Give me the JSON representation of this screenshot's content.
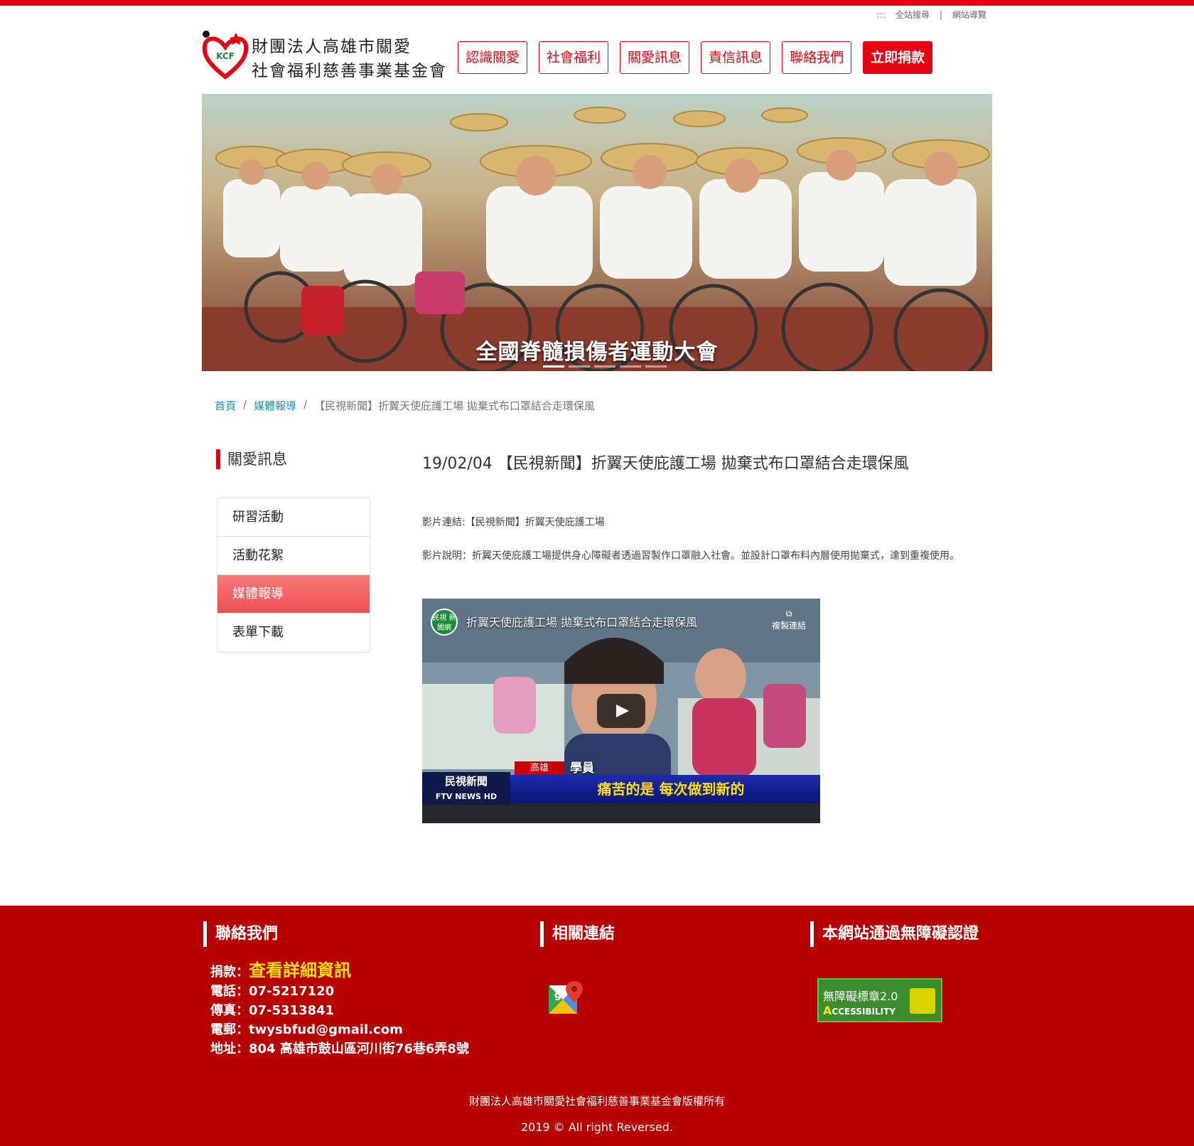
{
  "utility": {
    "prefix": ":::",
    "search": "全站搜尋",
    "sep": "|",
    "sitemap": "網站導覽"
  },
  "org": {
    "line1": "財團法人高雄市關愛",
    "line2": "社會福利慈善事業基金會",
    "logo_text": "KCF"
  },
  "nav": [
    "認識關愛",
    "社會福利",
    "關愛訊息",
    "責信訊息",
    "聯絡我們"
  ],
  "nav_donate": "立即捐款",
  "banner": {
    "caption": "全國脊髓損傷者運動大會"
  },
  "breadcrumb": {
    "home": "首頁",
    "section": "媒體報導",
    "current": "【民視新聞】折翼天使庇護工場 拋棄式布口罩結合走環保風",
    "sep": "/"
  },
  "sidebar": {
    "title": "關愛訊息",
    "items": [
      "研習活動",
      "活動花絮",
      "媒體報導",
      "表單下載"
    ],
    "active": "媒體報導"
  },
  "article": {
    "title": "19/02/04 【民視新聞】折翼天使庇護工場 拋棄式布口罩結合走環保風",
    "link_line": "影片連結:【民視新聞】折翼天使庇護工場",
    "desc_line": "影片說明：折翼天使庇護工場提供身心障礙者透過習製作口罩融入社會。並設計口罩布料內層使用拋棄式，達到重複使用。"
  },
  "video": {
    "title": "折翼天使庇護工場 拋棄式布口罩結合走環保風",
    "channel": "民視 新聞網",
    "copy_label": "複製連結",
    "location_tag": "高雄",
    "speaker_tag": "學員",
    "logo_line1": "民視新聞",
    "logo_line2": "FTV NEWS HD",
    "subtitle": "痛苦的是 每次做到新的"
  },
  "footer": {
    "contact_title": "聯絡我們",
    "links_title": "相關連結",
    "a11y_title": "本網站通過無障礙認證",
    "donate_label": "捐款：",
    "donate_link": "查看詳細資訊",
    "phone": "電話：07-5217120",
    "fax": "傳真：07-5313841",
    "email": "電郵：twysbfud@gmail.com",
    "address": "地址：804 高雄市鼓山區河川街76巷6弄8號",
    "a11y_badge_line1": "無障礙標章2.0",
    "a11y_badge_line2": "CCESSIBILITY",
    "copyright1": "財團法人高雄市關愛社會福利慈善事業基金會版權所有",
    "copyright2": "2019 © All right Reversed."
  },
  "colors": {
    "brand_red": "#e60012",
    "footer_red": "#b70000",
    "link_blue": "#1c8fb8",
    "highlight_yellow": "#ffe100"
  },
  "icons": [
    "kcf-heart-logo",
    "play-icon",
    "google-maps-icon",
    "accessibility-badge"
  ]
}
